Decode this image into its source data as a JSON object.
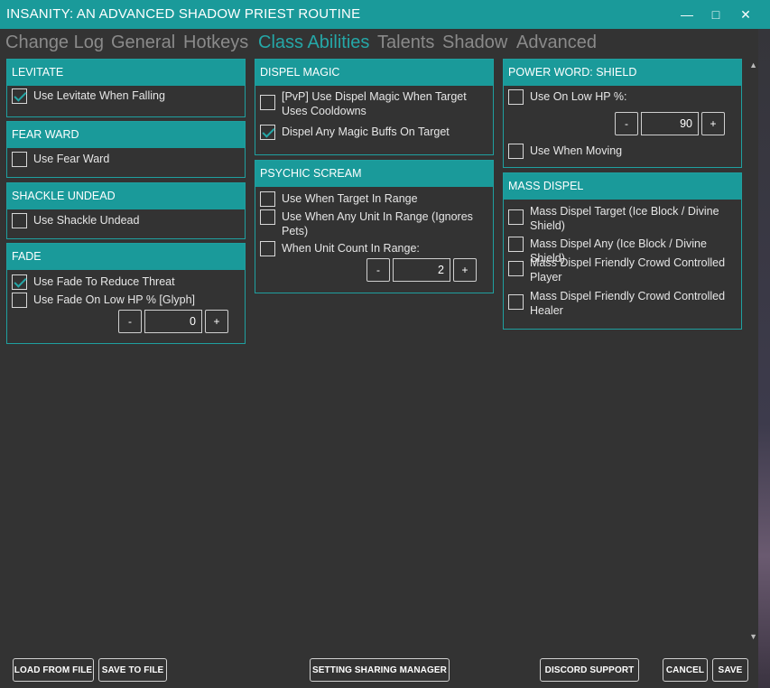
{
  "window": {
    "title": "INSANITY: AN ADVANCED SHADOW PRIEST ROUTINE",
    "minimize": "—",
    "maximize": "□",
    "close": "✕"
  },
  "tabs": [
    "Change Log",
    "General",
    "Hotkeys",
    "Class Abilities",
    "Talents",
    "Shadow",
    "Advanced"
  ],
  "active_tab": "Class Abilities",
  "panels": {
    "levitate": {
      "title": "LEVITATE",
      "opt1": "Use Levitate When Falling"
    },
    "fear_ward": {
      "title": "FEAR WARD",
      "opt1": "Use Fear Ward"
    },
    "shackle": {
      "title": "SHACKLE UNDEAD",
      "opt1": "Use Shackle Undead"
    },
    "fade": {
      "title": "FADE",
      "opt1": "Use Fade To Reduce Threat",
      "opt2": "Use Fade On Low HP % [Glyph]",
      "value": "0"
    },
    "dispel": {
      "title": "DISPEL MAGIC",
      "opt1": "[PvP] Use Dispel Magic When Target Uses Cooldowns",
      "opt2": "Dispel Any Magic Buffs On Target"
    },
    "scream": {
      "title": "PSYCHIC SCREAM",
      "opt1": "Use When Target In Range",
      "opt2": "Use When Any Unit In Range (Ignores Pets)",
      "opt3": "When Unit Count In Range:",
      "value": "2"
    },
    "pws": {
      "title": "POWER WORD: SHIELD",
      "opt1": "Use On Low HP %:",
      "opt2": "Use When Moving",
      "value": "90"
    },
    "mass": {
      "title": "MASS DISPEL",
      "opt1": "Mass Dispel Target (Ice Block / Divine Shield)",
      "opt2": "Mass Dispel Any (Ice Block / Divine Shield)",
      "opt3": "Mass Dispel Friendly Crowd Controlled Player",
      "opt4": "Mass Dispel Friendly Crowd Controlled Healer"
    }
  },
  "stepper": {
    "minus": "-",
    "plus": "+"
  },
  "footer": {
    "load": "LOAD FROM FILE",
    "save_file": "SAVE TO FILE",
    "sharing": "SETTING SHARING MANAGER",
    "discord": "DISCORD SUPPORT",
    "cancel": "CANCEL",
    "save": "SAVE"
  },
  "colors": {
    "accent": "#1a9a9a",
    "background": "#333333"
  }
}
